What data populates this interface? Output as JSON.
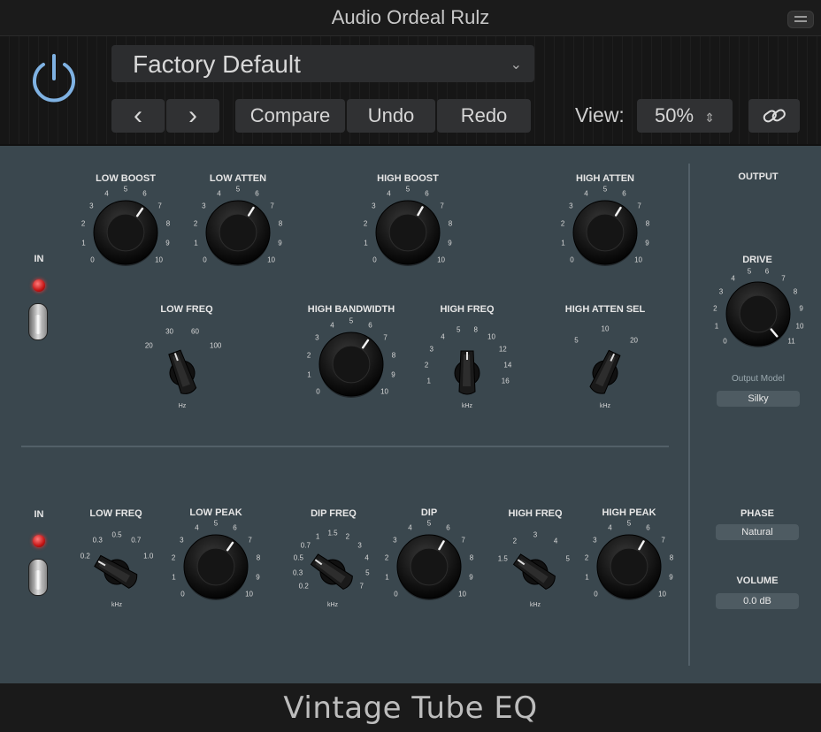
{
  "window": {
    "title": "Audio Ordeal Rulz"
  },
  "header": {
    "preset": "Factory Default",
    "prev_glyph": "‹",
    "next_glyph": "›",
    "compare": "Compare",
    "undo": "Undo",
    "redo": "Redo",
    "view_label": "View:",
    "view_value": "50%",
    "link_icon": "link-icon"
  },
  "plugin_name": "Vintage Tube EQ",
  "sections": {
    "top_in": "IN",
    "bottom_in": "IN",
    "output": "OUTPUT"
  },
  "knobs": [
    {
      "id": "low-boost",
      "label": "LOW BOOST",
      "ticks": [
        "0",
        "1",
        "2",
        "3",
        "4",
        "5",
        "6",
        "7",
        "8",
        "9",
        "10"
      ]
    },
    {
      "id": "low-atten",
      "label": "LOW ATTEN",
      "ticks": [
        "0",
        "1",
        "2",
        "3",
        "4",
        "5",
        "6",
        "7",
        "8",
        "9",
        "10"
      ]
    },
    {
      "id": "high-boost",
      "label": "HIGH BOOST",
      "ticks": [
        "0",
        "1",
        "2",
        "3",
        "4",
        "5",
        "6",
        "7",
        "8",
        "9",
        "10"
      ]
    },
    {
      "id": "high-atten",
      "label": "HIGH ATTEN",
      "ticks": [
        "0",
        "1",
        "2",
        "3",
        "4",
        "5",
        "6",
        "7",
        "8",
        "9",
        "10"
      ]
    },
    {
      "id": "high-bandwidth",
      "label": "HIGH BANDWIDTH",
      "ticks": [
        "0",
        "1",
        "2",
        "3",
        "4",
        "5",
        "6",
        "7",
        "8",
        "9",
        "10"
      ]
    },
    {
      "id": "drive",
      "label": "DRIVE",
      "ticks": [
        "0",
        "1",
        "2",
        "3",
        "4",
        "5",
        "6",
        "7",
        "8",
        "9",
        "10",
        "11"
      ]
    },
    {
      "id": "low-peak",
      "label": "LOW PEAK",
      "ticks": [
        "0",
        "1",
        "2",
        "3",
        "4",
        "5",
        "6",
        "7",
        "8",
        "9",
        "10"
      ]
    },
    {
      "id": "dip",
      "label": "DIP",
      "ticks": [
        "0",
        "1",
        "2",
        "3",
        "4",
        "5",
        "6",
        "7",
        "8",
        "9",
        "10"
      ]
    },
    {
      "id": "high-peak",
      "label": "HIGH PEAK",
      "ticks": [
        "0",
        "1",
        "2",
        "3",
        "4",
        "5",
        "6",
        "7",
        "8",
        "9",
        "10"
      ]
    }
  ],
  "switches": [
    {
      "id": "low-freq-top",
      "label": "LOW FREQ",
      "ticks": [
        "20",
        "30",
        "60",
        "100"
      ],
      "unit": "Hz"
    },
    {
      "id": "high-freq-top",
      "label": "HIGH FREQ",
      "ticks": [
        "1",
        "2",
        "3",
        "4",
        "5",
        "8",
        "10",
        "12",
        "14",
        "16"
      ],
      "unit": "kHz"
    },
    {
      "id": "high-atten-sel",
      "label": "HIGH ATTEN SEL",
      "ticks": [
        "5",
        "10",
        "20"
      ],
      "unit": "kHz"
    },
    {
      "id": "low-freq-bottom",
      "label": "LOW FREQ",
      "ticks": [
        "0.2",
        "0.3",
        "0.5",
        "0.7",
        "1.0"
      ],
      "unit": "kHz"
    },
    {
      "id": "dip-freq",
      "label": "DIP FREQ",
      "ticks": [
        "0.2",
        "0.3",
        "0.5",
        "0.7",
        "1",
        "1.5",
        "2",
        "3",
        "4",
        "5",
        "7"
      ],
      "unit": "kHz"
    },
    {
      "id": "high-freq-bottom",
      "label": "HIGH FREQ",
      "ticks": [
        "1.5",
        "2",
        "3",
        "4",
        "5"
      ],
      "unit": "kHz"
    }
  ],
  "output_model": {
    "label": "Output Model",
    "value": "Silky"
  },
  "phase": {
    "label": "PHASE",
    "value": "Natural"
  },
  "volume": {
    "label": "VOLUME",
    "value": "0.0 dB"
  }
}
